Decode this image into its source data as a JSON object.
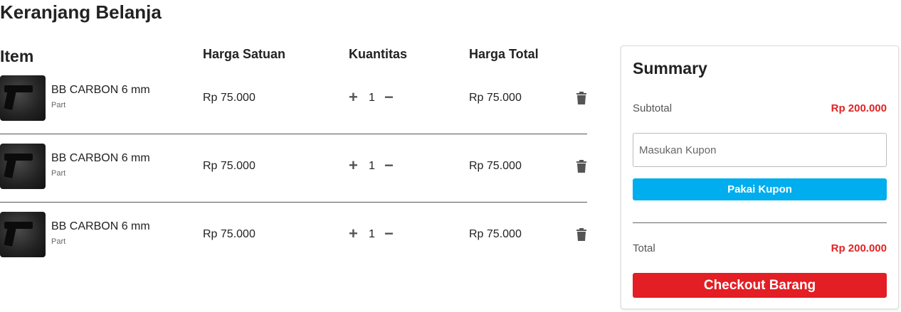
{
  "page_title": "Keranjang Belanja",
  "columns": {
    "item": "Item",
    "unit_price": "Harga Satuan",
    "quantity": "Kuantitas",
    "total_price": "Harga Total"
  },
  "items": [
    {
      "name": "BB CARBON 6 mm",
      "category": "Part",
      "unit_price": "Rp 75.000",
      "quantity": "1",
      "total": "Rp 75.000"
    },
    {
      "name": "BB CARBON 6 mm",
      "category": "Part",
      "unit_price": "Rp 75.000",
      "quantity": "1",
      "total": "Rp 75.000"
    },
    {
      "name": "BB CARBON 6 mm",
      "category": "Part",
      "unit_price": "Rp 75.000",
      "quantity": "1",
      "total": "Rp 75.000"
    }
  ],
  "icons": {
    "increase": "plus-icon",
    "decrease": "minus-icon",
    "delete": "trash-icon"
  },
  "summary": {
    "title": "Summary",
    "subtotal_label": "Subtotal",
    "subtotal_value": "Rp 200.000",
    "coupon_placeholder": "Masukan Kupon",
    "coupon_value": "",
    "apply_coupon_label": "Pakai Kupon",
    "total_label": "Total",
    "total_value": "Rp 200.000",
    "checkout_label": "Checkout Barang"
  },
  "colors": {
    "accent_blue": "#00adee",
    "checkout_red": "#e31e24",
    "price_red": "#e02424"
  }
}
